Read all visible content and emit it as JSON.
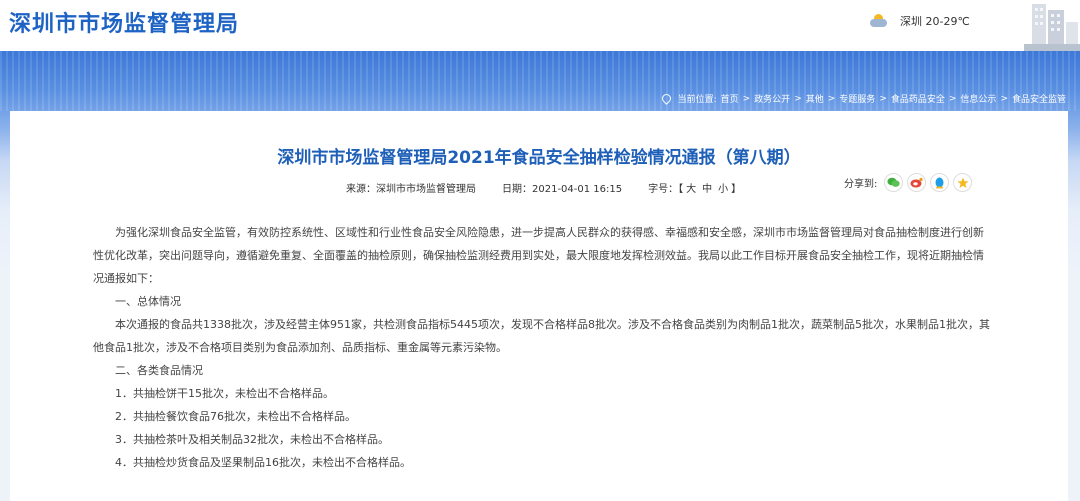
{
  "header": {
    "site_title": "深圳市市场监督管理局",
    "weather_text": "深圳 20-29℃",
    "weather_icon": "partly-cloudy-icon"
  },
  "breadcrumb": {
    "label": "当前位置:",
    "items": [
      "首页",
      "政务公开",
      "其他",
      "专题服务",
      "食品药品安全",
      "信息公示",
      "食品安全监管"
    ],
    "separator": ">"
  },
  "article": {
    "title": "深圳市市场监督管理局2021年食品安全抽样检验情况通报（第八期）",
    "source": "来源：深圳市市场监督管理局",
    "date": "日期：2021-04-01 16:15",
    "font_label": "字号：",
    "font_open": "【",
    "font_large": "大",
    "font_medium": "中",
    "font_small": "小",
    "font_close": "】",
    "share_label": "分享到:",
    "share_icons": [
      "wechat-icon",
      "weibo-icon",
      "qq-icon",
      "qzone-icon"
    ],
    "paragraphs": [
      "为强化深圳食品安全监管，有效防控系统性、区域性和行业性食品安全风险隐患，进一步提高人民群众的获得感、幸福感和安全感，深圳市市场监督管理局对食品抽检制度进行创新性优化改革，突出问题导向，遵循避免重复、全面覆盖的抽检原则，确保抽检监测经费用到实处，最大限度地发挥检测效益。我局以此工作目标开展食品安全抽检工作，现将近期抽检情况通报如下：",
      "一、总体情况",
      "本次通报的食品共1338批次，涉及经营主体951家，共检测食品指标5445项次，发现不合格样品8批次。涉及不合格食品类别为肉制品1批次，蔬菜制品5批次，水果制品1批次，其他食品1批次，涉及不合格项目类别为食品添加剂、品质指标、重金属等元素污染物。",
      "二、各类食品情况",
      "1．共抽检饼干15批次，未检出不合格样品。",
      "2．共抽检餐饮食品76批次，未检出不合格样品。",
      "3．共抽检茶叶及相关制品32批次，未检出不合格样品。",
      "4．共抽检炒货食品及坚果制品16批次，未检出不合格样品。"
    ]
  }
}
